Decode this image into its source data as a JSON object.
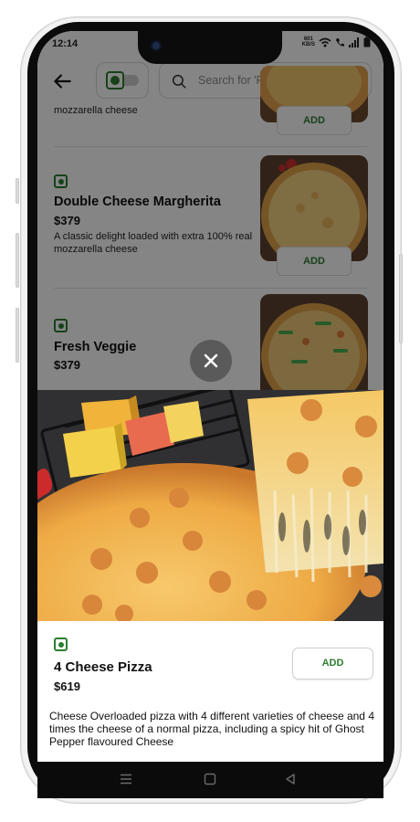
{
  "status_bar": {
    "time": "12:14",
    "speed_value": "601",
    "speed_unit": "KB/S",
    "icons": [
      "wifi-icon",
      "call-icon",
      "signal-icon",
      "battery-icon"
    ]
  },
  "header": {
    "back_icon": "arrow-left-icon",
    "veg_toggle": "veg-only-toggle",
    "search_placeholder": "Search for 'Pizzas'"
  },
  "menu_items": [
    {
      "desc_fragment": "mozzarella cheese",
      "add_label": "ADD"
    },
    {
      "name": "Double Cheese Margherita",
      "price": "$379",
      "description": "A classic delight loaded with extra 100% real mozzarella cheese",
      "add_label": "ADD"
    },
    {
      "name": "Fresh Veggie",
      "price": "$379"
    }
  ],
  "sheet": {
    "close_icon": "close-icon",
    "name": "4 Cheese Pizza",
    "price": "$619",
    "add_label": "ADD",
    "description": "Cheese Overloaded pizza with 4 different varieties of cheese and 4 times the cheese of a normal pizza, including a spicy hit of Ghost Pepper flavoured Cheese"
  },
  "nav_bar": {
    "icons": [
      "menu-icon",
      "home-icon",
      "back-triangle-icon"
    ]
  },
  "colors": {
    "veg_green": "#2e7d32",
    "add_text": "#2e7d32",
    "overlay": "rgba(0,0,0,0.48)"
  }
}
